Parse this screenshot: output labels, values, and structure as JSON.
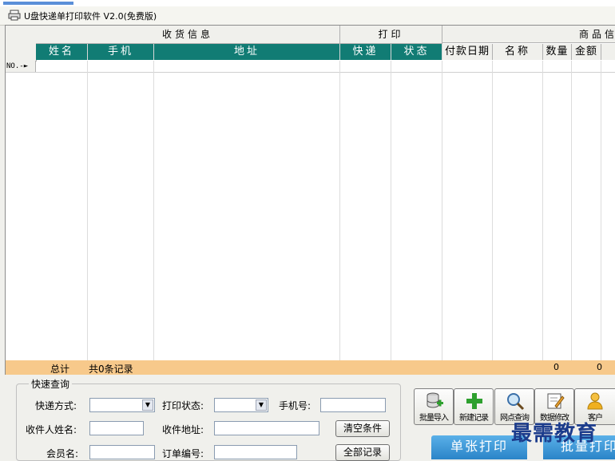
{
  "window": {
    "title": "U盘快递单打印软件 V2.0(免费版)"
  },
  "grid": {
    "groups": {
      "receiver": "收货信息",
      "print": "打印",
      "product": "商品信"
    },
    "columns": {
      "name": "姓名",
      "phone": "手机",
      "address": "地址",
      "express": "快递",
      "status": "状态",
      "pay_date": "付款日期",
      "product_name": "名称",
      "qty": "数量",
      "amount": "金额"
    },
    "row_marker": "NO.-",
    "totals": {
      "label": "总计",
      "count_text": "共0条记录",
      "qty_total": "0",
      "amount_total": "0"
    }
  },
  "quick_search": {
    "title": "快速查询",
    "express_label": "快递方式:",
    "express_value": "",
    "print_status_label": "打印状态:",
    "print_status_value": "",
    "phone_label": "手机号:",
    "phone_value": "",
    "receiver_name_label": "收件人姓名:",
    "receiver_name_value": "",
    "address_label": "收件地址:",
    "address_value": "",
    "member_label": "会员名:",
    "member_value": "",
    "order_label": "订单编号:",
    "order_value": "",
    "clear_button": "清空条件",
    "all_button": "全部记录"
  },
  "toolbar": {
    "import": "批量导入",
    "new_record": "新建记录",
    "query": "网点查询",
    "edit": "数据修改",
    "member": "客户"
  },
  "actions": {
    "single_print": "单张打印",
    "batch_print": "批量打印"
  },
  "watermark": "最需教育",
  "colors": {
    "header_teal": "#117c74",
    "totals_orange": "#f7c98b",
    "action_blue": "#2a84c8"
  }
}
